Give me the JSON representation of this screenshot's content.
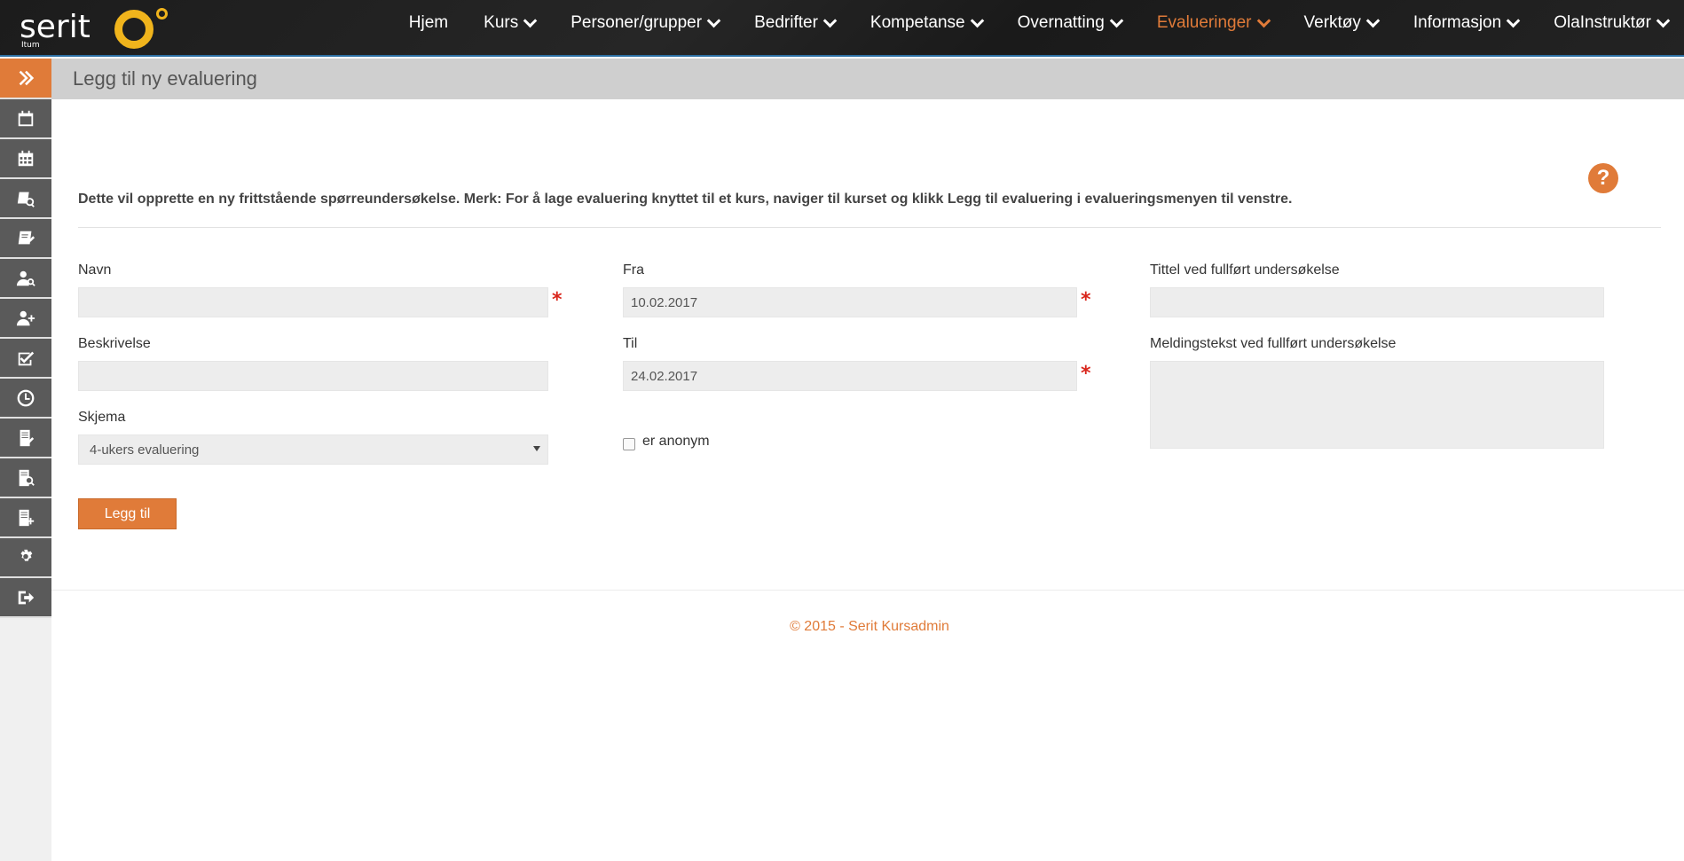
{
  "app": {
    "logo_text": "serit",
    "logo_sub": "Itum",
    "brand_color": "#e07b39"
  },
  "nav": {
    "items": [
      {
        "label": "Hjem",
        "dropdown": false
      },
      {
        "label": "Kurs",
        "dropdown": true
      },
      {
        "label": "Personer/grupper",
        "dropdown": true
      },
      {
        "label": "Bedrifter",
        "dropdown": true
      },
      {
        "label": "Kompetanse",
        "dropdown": true
      },
      {
        "label": "Overnatting",
        "dropdown": true
      },
      {
        "label": "Evalueringer",
        "dropdown": true,
        "active": true
      },
      {
        "label": "Verktøy",
        "dropdown": true
      },
      {
        "label": "Informasjon",
        "dropdown": true
      },
      {
        "label": "OlaInstruktør",
        "dropdown": true
      }
    ]
  },
  "sidebar": {
    "icons": [
      "double-chevron-right-icon",
      "calendar-icon",
      "calendar-grid-icon",
      "book-search-icon",
      "book-edit-icon",
      "user-search-icon",
      "user-add-icon",
      "checkbox-icon",
      "clock-icon",
      "document-edit-icon",
      "document-search-icon",
      "document-add-icon",
      "gear-icon",
      "sign-out-icon"
    ]
  },
  "page": {
    "title": "Legg til ny evaluering",
    "intro": "Dette vil opprette en ny frittstående spørreundersøkelse. Merk: For å lage evaluering knyttet til et kurs, naviger til kurset og klikk Legg til evaluering i evalueringsmenyen til venstre."
  },
  "form": {
    "navn_label": "Navn",
    "navn_value": "",
    "beskrivelse_label": "Beskrivelse",
    "beskrivelse_value": "",
    "skjema_label": "Skjema",
    "skjema_value": "4-ukers evaluering",
    "fra_label": "Fra",
    "fra_value": "10.02.2017",
    "til_label": "Til",
    "til_value": "24.02.2017",
    "anonym_label": "er anonym",
    "anonym_checked": false,
    "tittel_label": "Tittel ved fullført undersøkelse",
    "tittel_value": "",
    "melding_label": "Meldingstekst ved fullført undersøkelse",
    "melding_value": "",
    "required_mark": "*",
    "submit_label": "Legg til"
  },
  "footer": {
    "text": "© 2015 - Serit Kursadmin"
  }
}
